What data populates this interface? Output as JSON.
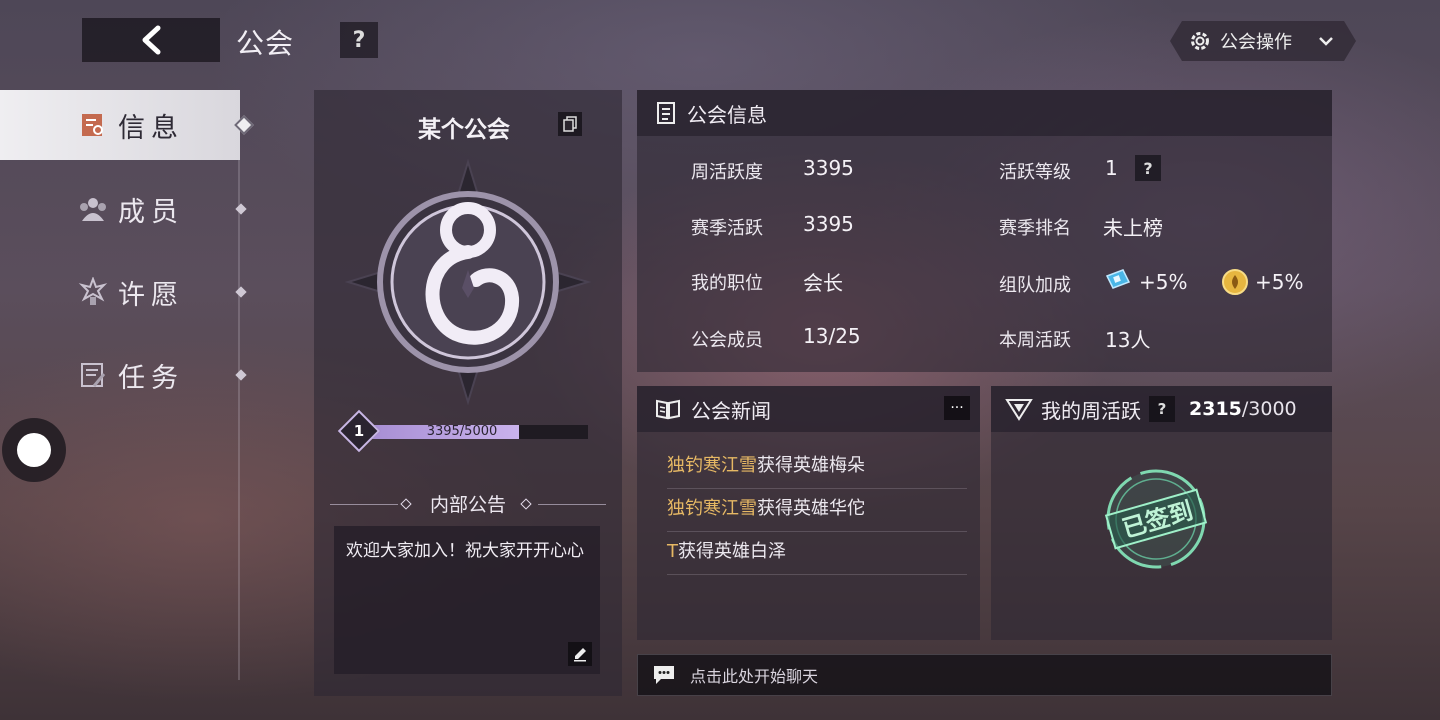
{
  "header": {
    "title": "公会",
    "help_label": "?",
    "guild_ops_label": "公会操作"
  },
  "sidebar": {
    "items": [
      {
        "label": "信息",
        "icon": "info-icon",
        "active": true
      },
      {
        "label": "成员",
        "icon": "members-icon",
        "active": false
      },
      {
        "label": "许愿",
        "icon": "wish-icon",
        "active": false
      },
      {
        "label": "任务",
        "icon": "task-icon",
        "active": false
      }
    ]
  },
  "guild_card": {
    "name": "某个公会",
    "level": "1",
    "exp_text": "3395/5000",
    "exp_fraction": 0.679,
    "notice_title": "内部公告",
    "notice_text": "欢迎大家加入！祝大家开开心心"
  },
  "guild_info": {
    "title": "公会信息",
    "fields": {
      "weekly_activity_label": "周活跃度",
      "weekly_activity_value": "3395",
      "season_activity_label": "赛季活跃",
      "season_activity_value": "3395",
      "my_position_label": "我的职位",
      "my_position_value": "会长",
      "members_label": "公会成员",
      "members_value": "13/25",
      "activity_level_label": "活跃等级",
      "activity_level_value": "1",
      "season_rank_label": "赛季排名",
      "season_rank_value": "未上榜",
      "team_bonus_label": "组队加成",
      "team_bonus_ticket": "+5%",
      "team_bonus_coin": "+5%",
      "week_active_label": "本周活跃",
      "week_active_value": "13人"
    }
  },
  "news": {
    "title": "公会新闻",
    "more_label": "···",
    "items": [
      {
        "name": "独钓寒江雪",
        "text": "获得英雄梅朵"
      },
      {
        "name": "独钓寒江雪",
        "text": "获得英雄华佗"
      },
      {
        "name": "T",
        "text": "获得英雄白泽"
      }
    ]
  },
  "weekly": {
    "title": "我的周活跃",
    "help_label": "?",
    "current": "2315",
    "total": "/3000",
    "stamp_text": "已签到"
  },
  "chat": {
    "placeholder": "点击此处开始聊天"
  },
  "colors": {
    "accent_gold": "#e6b864",
    "exp_bar": "#c9b2ec",
    "stamp_green": "#bff3d6"
  }
}
